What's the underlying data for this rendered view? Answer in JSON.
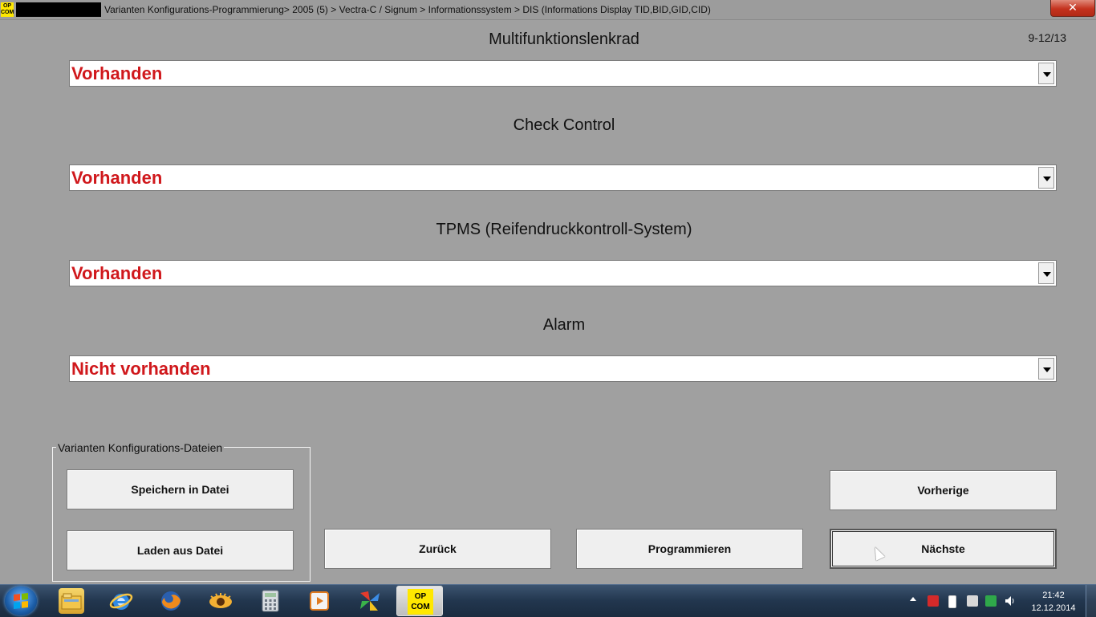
{
  "window": {
    "app_icon_label": "OP COM",
    "title": "Varianten Konfigurations-Programmierung> 2005 (5) > Vectra-C / Signum > Informationssystem > DIS (Informations Display TID,BID,GID,CID)",
    "close_label": "✕"
  },
  "page_counter": "9-12/13",
  "fields": [
    {
      "label": "Multifunktionslenkrad",
      "value": "Vorhanden"
    },
    {
      "label": "Check Control",
      "value": "Vorhanden"
    },
    {
      "label": "TPMS (Reifendruckkontroll-System)",
      "value": "Vorhanden"
    },
    {
      "label": "Alarm",
      "value": "Nicht vorhanden"
    }
  ],
  "file_group": {
    "title": "Varianten Konfigurations-Dateien",
    "save_label": "Speichern in Datei",
    "load_label": "Laden aus Datei"
  },
  "buttons": {
    "back": "Zurück",
    "program": "Programmieren",
    "previous": "Vorherige",
    "next": "Nächste"
  },
  "taskbar": {
    "items": [
      "explorer-icon",
      "internet-explorer-icon",
      "firefox-icon",
      "eye-app-icon",
      "calculator-icon",
      "media-player-icon",
      "pinwheel-app-icon",
      "opcom-icon"
    ],
    "opcom_label": "OP COM",
    "clock_time": "21:42",
    "clock_date": "12.12.2014"
  },
  "colors": {
    "value_text": "#d0181c",
    "background": "#a0a0a0",
    "app_icon": "#ffe800"
  }
}
